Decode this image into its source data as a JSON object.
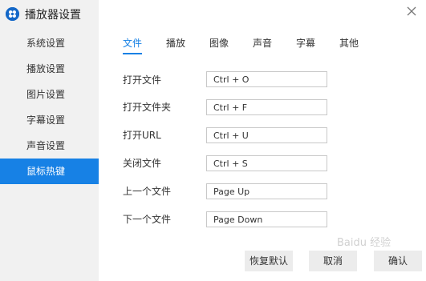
{
  "app": {
    "title": "播放器设置"
  },
  "sidebar": {
    "items": [
      {
        "label": "系统设置"
      },
      {
        "label": "播放设置"
      },
      {
        "label": "图片设置"
      },
      {
        "label": "字幕设置"
      },
      {
        "label": "声音设置"
      },
      {
        "label": "鼠标热键",
        "active": true
      }
    ]
  },
  "tabs": [
    {
      "label": "文件",
      "active": true
    },
    {
      "label": "播放"
    },
    {
      "label": "图像"
    },
    {
      "label": "声音"
    },
    {
      "label": "字幕"
    },
    {
      "label": "其他"
    }
  ],
  "hotkeys": [
    {
      "label": "打开文件",
      "value": "Ctrl + O"
    },
    {
      "label": "打开文件夹",
      "value": "Ctrl + F"
    },
    {
      "label": "打开URL",
      "value": "Ctrl + U"
    },
    {
      "label": "关闭文件",
      "value": "Ctrl + S"
    },
    {
      "label": "上一个文件",
      "value": "Page Up"
    },
    {
      "label": "下一个文件",
      "value": "Page Down"
    }
  ],
  "buttons": {
    "restore_defaults": "恢复默认",
    "cancel": "取消",
    "confirm": "确认"
  },
  "watermark": "Baidu 经验",
  "colors": {
    "accent": "#1781e5",
    "sidebar_bg": "#f1f1f1",
    "logo": "#1468c8"
  },
  "icons": {
    "logo": "player-logo-icon",
    "close": "close-icon"
  }
}
